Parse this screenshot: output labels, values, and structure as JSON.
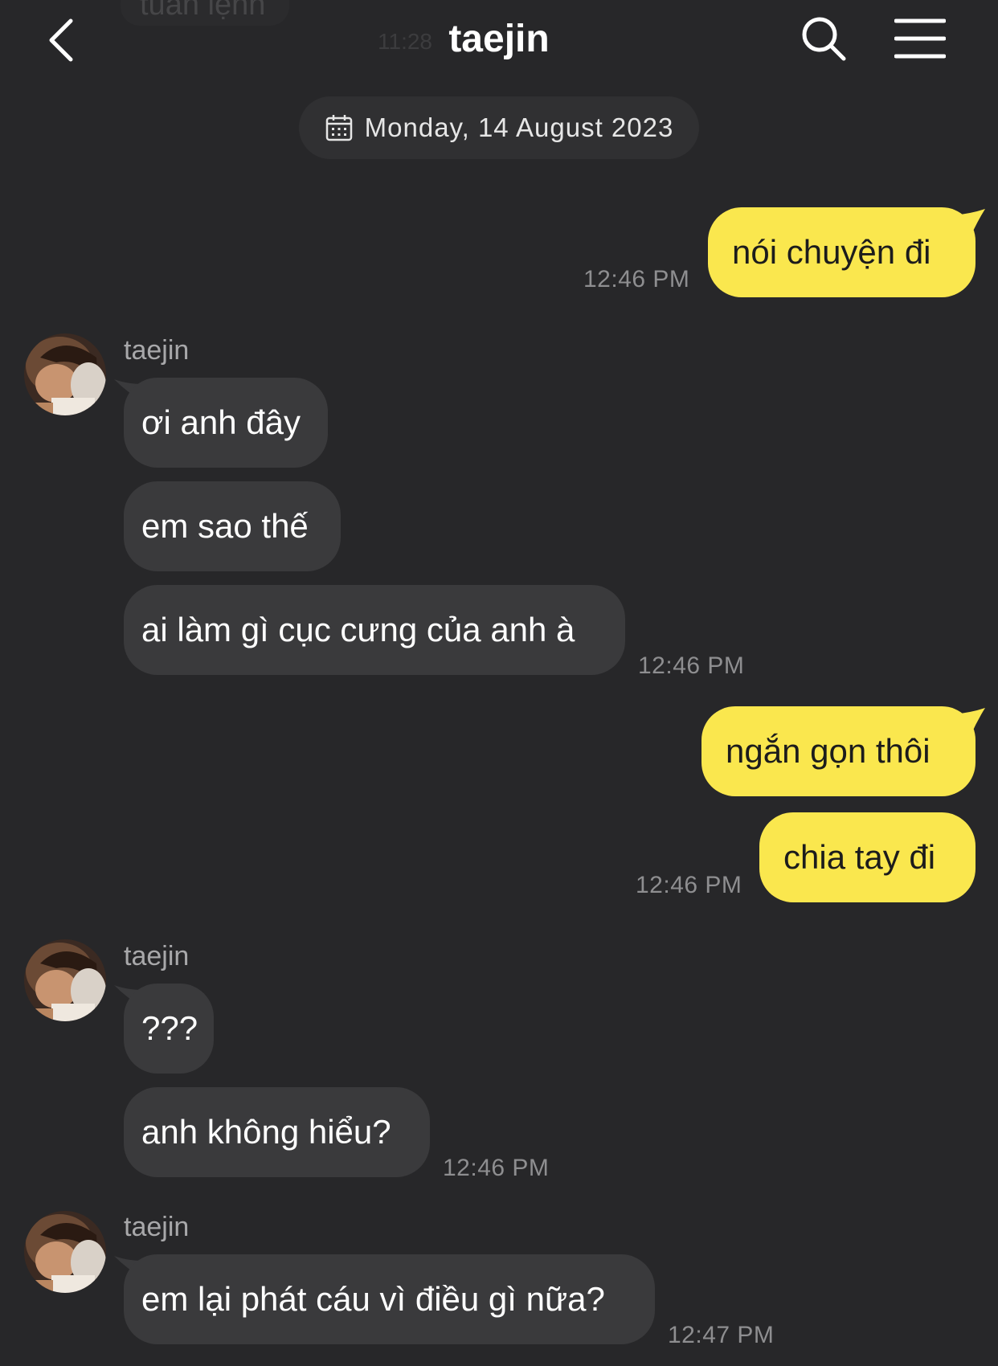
{
  "header": {
    "title": "taejin",
    "back_icon": "chevron-left-icon",
    "search_icon": "search-icon",
    "menu_icon": "hamburger-menu-icon",
    "partial_previous_message": "tuân lệnh",
    "partial_previous_time": "11:28"
  },
  "date_divider": {
    "icon": "calendar-icon",
    "label": "Monday, 14 August 2023"
  },
  "colors": {
    "background": "#272729",
    "outgoing_bubble": "#fae74e",
    "incoming_bubble": "#3a3a3c",
    "timestamp": "#8e8e90"
  },
  "messages": {
    "m1": {
      "text": "nói chuyện đi",
      "time": "12:46 PM",
      "direction": "outgoing"
    },
    "g1_sender": "taejin",
    "m2": {
      "text": "ơi anh đây",
      "direction": "incoming"
    },
    "m3": {
      "text": "em sao thế",
      "direction": "incoming"
    },
    "m4": {
      "text": "ai làm gì cục cưng của anh à",
      "time": "12:46 PM",
      "direction": "incoming"
    },
    "m5": {
      "text": "ngắn gọn thôi",
      "direction": "outgoing"
    },
    "m6": {
      "text": "chia tay đi",
      "time": "12:46 PM",
      "direction": "outgoing"
    },
    "g2_sender": "taejin",
    "m7": {
      "text": "???",
      "direction": "incoming"
    },
    "m8": {
      "text": "anh không hiểu?",
      "time": "12:46 PM",
      "direction": "incoming"
    },
    "g3_sender": "taejin",
    "m9": {
      "text": "em lại phát cáu vì điều gì nữa?",
      "time": "12:47 PM",
      "direction": "incoming"
    }
  }
}
